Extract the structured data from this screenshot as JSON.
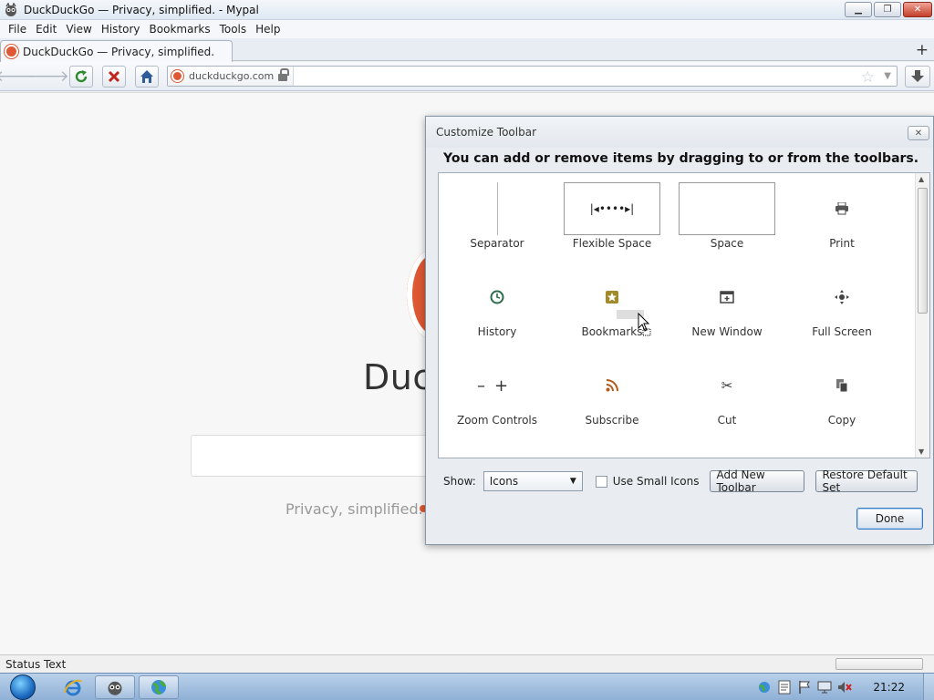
{
  "window": {
    "title": "DuckDuckGo — Privacy, simplified. - Mypal",
    "minimize_icon": "minimize-icon",
    "restore_icon": "restore-icon",
    "close_icon": "close-icon"
  },
  "menubar": {
    "items": [
      "File",
      "Edit",
      "View",
      "History",
      "Bookmarks",
      "Tools",
      "Help"
    ]
  },
  "tabs": [
    {
      "title": "DuckDuckGo — Privacy, simplified.",
      "icon": "duckduckgo-favicon"
    }
  ],
  "navbar": {
    "url": "duckduckgo.com",
    "icons": [
      "back-icon",
      "forward-icon",
      "reload-icon",
      "stop-icon",
      "home-icon",
      "lock-icon",
      "star-icon",
      "download-icon"
    ]
  },
  "page": {
    "wordmark": "Duck",
    "tagline": "Privacy, simplified.",
    "brand_color": "#de5833"
  },
  "dialog": {
    "title": "Customize Toolbar",
    "instructions": "You can add or remove items by dragging to or from the toolbars.",
    "items": [
      {
        "label": "Separator",
        "icon": "separator-icon"
      },
      {
        "label": "Flexible Space",
        "icon": "flexible-space-icon"
      },
      {
        "label": "Space",
        "icon": "space-icon"
      },
      {
        "label": "Print",
        "icon": "print-icon"
      },
      {
        "label": "History",
        "icon": "history-icon"
      },
      {
        "label": "Bookmarks",
        "icon": "bookmarks-icon"
      },
      {
        "label": "New Window",
        "icon": "new-window-icon"
      },
      {
        "label": "Full Screen",
        "icon": "full-screen-icon"
      },
      {
        "label": "Zoom Controls",
        "icon": "zoom-controls-icon"
      },
      {
        "label": "Subscribe",
        "icon": "subscribe-icon"
      },
      {
        "label": "Cut",
        "icon": "cut-icon"
      },
      {
        "label": "Copy",
        "icon": "copy-icon"
      }
    ],
    "show_label": "Show:",
    "show_value": "Icons",
    "small_icons_label": "Use Small Icons",
    "small_icons_checked": false,
    "add_toolbar_label": "Add New Toolbar",
    "restore_label": "Restore Default Set",
    "done_label": "Done"
  },
  "statusbar": {
    "text": "Status Text"
  },
  "taskbar": {
    "clock": "21:22",
    "apps": [
      "internet-explorer-icon",
      "mypal-icon",
      "globe-icon"
    ],
    "tray_icons": [
      "network-icon",
      "document-icon",
      "flag-icon",
      "display-icon",
      "volume-muted-icon"
    ]
  }
}
